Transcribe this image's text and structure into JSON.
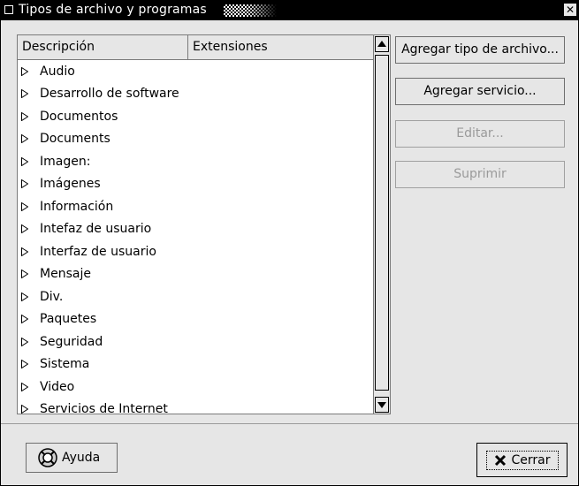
{
  "window": {
    "title": "Tipos de archivo y programas",
    "close_glyph": "✕"
  },
  "list": {
    "columns": [
      "Descripción",
      "Extensiones"
    ],
    "rows": [
      "Audio",
      "Desarrollo de software",
      "Documentos",
      "Documents",
      "Imagen:",
      "Imágenes",
      "Información",
      "Intefaz de usuario",
      "Interfaz de usuario",
      "Mensaje",
      "Div.",
      "Paquetes",
      "Seguridad",
      "Sistema",
      "Video",
      "Servicios de Internet"
    ]
  },
  "buttons": {
    "add_type": "Agregar tipo de archivo...",
    "add_service": "Agregar servicio...",
    "edit": "Editar...",
    "delete": "Suprimir"
  },
  "footer": {
    "help": "Ayuda",
    "close": "Cerrar"
  }
}
